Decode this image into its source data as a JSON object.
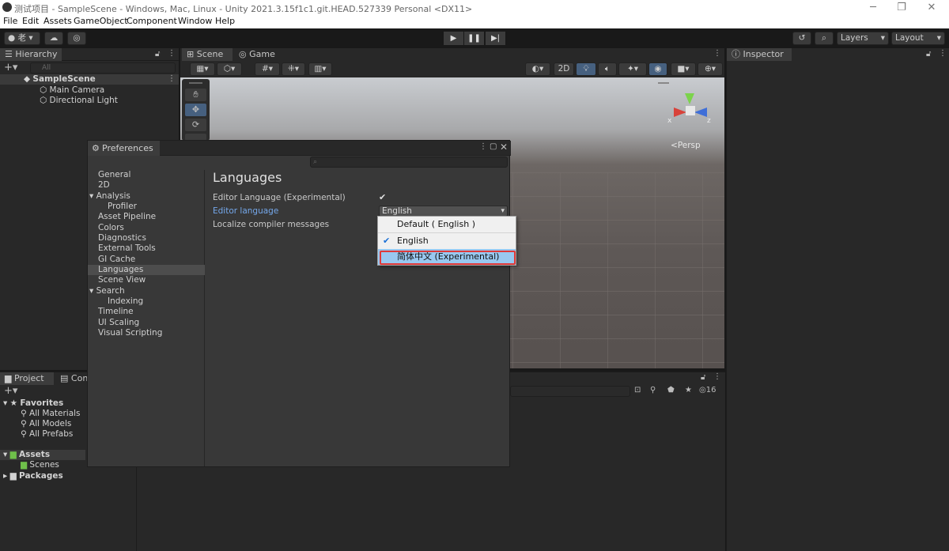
{
  "window": {
    "title": "测试项目 - SampleScene - Windows, Mac, Linux - Unity 2021.3.15f1c1.git.HEAD.527339 Personal <DX11>"
  },
  "menu": [
    "File",
    "Edit",
    "Assets",
    "GameObject",
    "Component",
    "Window",
    "Help"
  ],
  "toolbar": {
    "account_label": "老",
    "layers_label": "Layers",
    "layout_label": "Layout"
  },
  "hierarchy": {
    "tab": "Hierarchy",
    "search_placeholder": "All",
    "scene": "SampleScene",
    "objects": [
      "Main Camera",
      "Directional Light"
    ]
  },
  "scene": {
    "tabs": [
      "Scene",
      "Game"
    ],
    "mode_2d": "2D",
    "persp_label": "Persp",
    "axis_x": "x",
    "axis_z": "z"
  },
  "inspector": {
    "tab": "Inspector"
  },
  "project": {
    "tabs": [
      "Project",
      "Cons"
    ],
    "favorites_label": "Favorites",
    "favorites": [
      "All Materials",
      "All Models",
      "All Prefabs"
    ],
    "assets_label": "Assets",
    "assets_children": [
      "Scenes"
    ],
    "packages_label": "Packages",
    "hidden_count": "16"
  },
  "preferences": {
    "title": "Preferences",
    "search_placeholder": "",
    "sidebar": [
      {
        "label": "General",
        "indent": 0
      },
      {
        "label": "2D",
        "indent": 0
      },
      {
        "label": "Analysis",
        "indent": 0,
        "expanded": true
      },
      {
        "label": "Profiler",
        "indent": 1
      },
      {
        "label": "Asset Pipeline",
        "indent": 0
      },
      {
        "label": "Colors",
        "indent": 0
      },
      {
        "label": "Diagnostics",
        "indent": 0
      },
      {
        "label": "External Tools",
        "indent": 0
      },
      {
        "label": "GI Cache",
        "indent": 0
      },
      {
        "label": "Languages",
        "indent": 0,
        "selected": true
      },
      {
        "label": "Scene View",
        "indent": 0
      },
      {
        "label": "Search",
        "indent": 0,
        "expanded": true
      },
      {
        "label": "Indexing",
        "indent": 1
      },
      {
        "label": "Timeline",
        "indent": 0
      },
      {
        "label": "UI Scaling",
        "indent": 0
      },
      {
        "label": "Visual Scripting",
        "indent": 0
      }
    ],
    "heading": "Languages",
    "editor_language_experimental_label": "Editor Language (Experimental)",
    "editor_language_experimental_checked": true,
    "editor_language_label": "Editor language",
    "editor_language_value": "English",
    "localize_label": "Localize compiler messages"
  },
  "language_popup": {
    "options": [
      "Default ( English )",
      "English",
      "简体中文 (Experimental)"
    ],
    "checked_index": 1,
    "highlighted_index": 2
  },
  "colors": {
    "accent_link": "#74a7ea",
    "highlight_red": "#e03a3a",
    "popup_selected": "#99c8f0"
  }
}
